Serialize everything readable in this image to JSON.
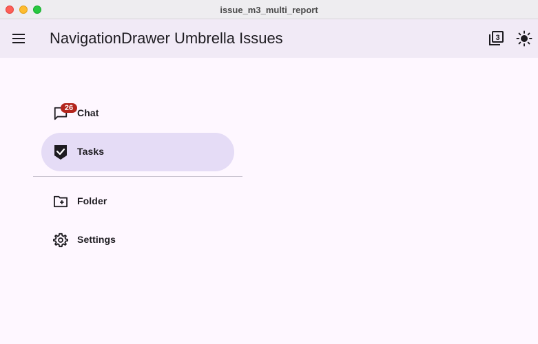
{
  "window": {
    "title": "issue_m3_multi_report"
  },
  "appbar": {
    "title": "NavigationDrawer Umbrella Issues",
    "menu_icon": "menu-icon",
    "filter_icon": "filter-3-icon",
    "filter_value": "3",
    "theme_icon": "sun-icon"
  },
  "drawer": {
    "items": [
      {
        "label": "Chat",
        "icon": "chat-bubble-icon",
        "badge": "26",
        "selected": false
      },
      {
        "label": "Tasks",
        "icon": "check-shield-icon",
        "selected": true
      },
      {
        "label": "Folder",
        "icon": "folder-add-icon",
        "selected": false
      },
      {
        "label": "Settings",
        "icon": "gear-icon",
        "selected": false
      }
    ]
  },
  "colors": {
    "surface": "#fef7ff",
    "appbar": "#f1eaf6",
    "selected_indicator": "#e5dcf6",
    "badge": "#b3261e",
    "on_surface": "#1d1b20"
  }
}
